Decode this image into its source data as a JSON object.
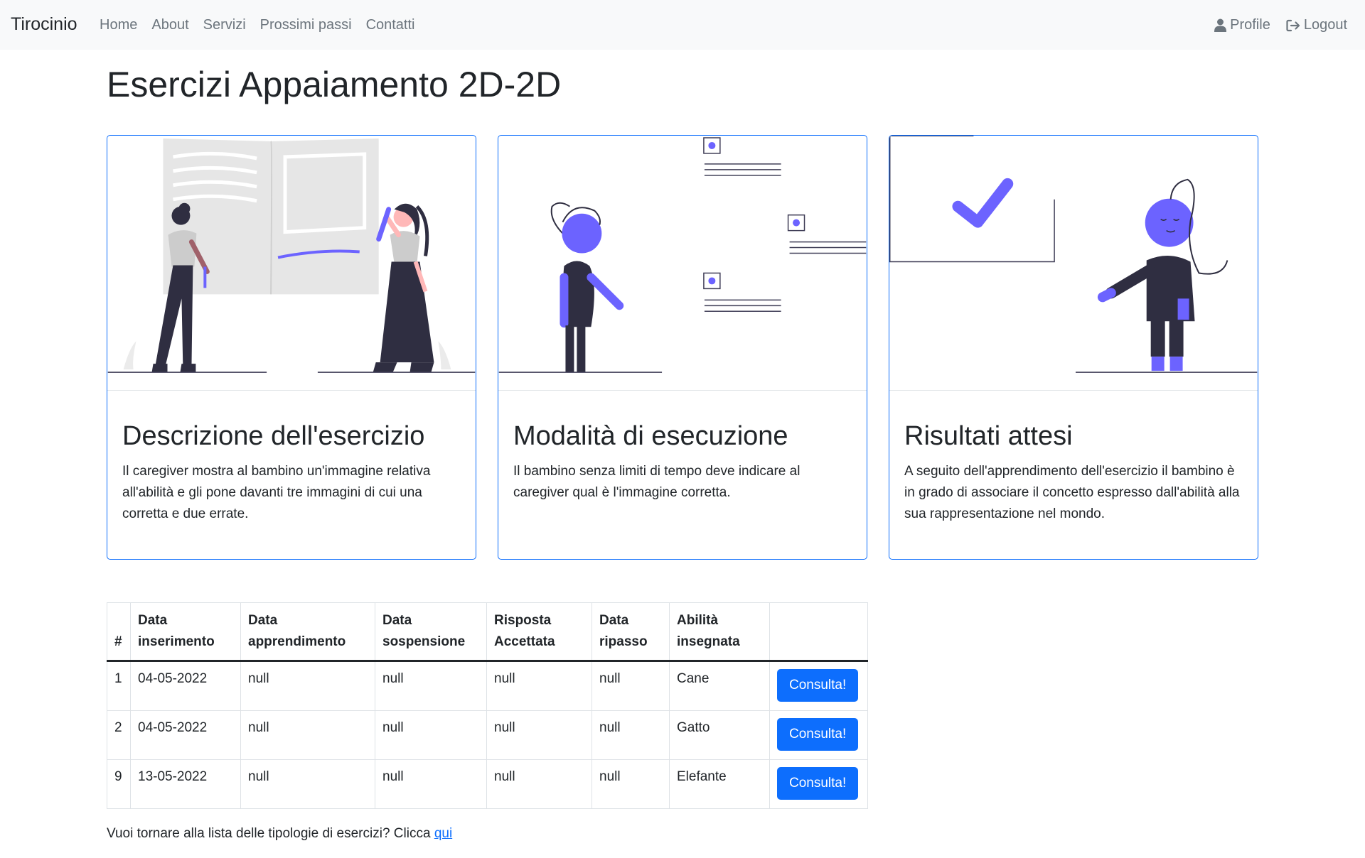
{
  "navbar": {
    "brand": "Tirocinio",
    "links": [
      "Home",
      "About",
      "Servizi",
      "Prossimi passi",
      "Contatti"
    ],
    "profile_label": "Profile",
    "logout_label": "Logout"
  },
  "page_title": "Esercizi Appaiamento 2D-2D",
  "cards": [
    {
      "title": "Descrizione dell'esercizio",
      "text": "Il caregiver mostra al bambino un'immagine relativa all'abilità e gli pone davanti tre immagini di cui una corretta e due errate."
    },
    {
      "title": "Modalità di esecuzione",
      "text": "Il bambino senza limiti di tempo deve indicare al caregiver qual è l'immagine corretta."
    },
    {
      "title": "Risultati attesi",
      "text": "A seguito dell'apprendimento dell'esercizio il bambino è in grado di associare il concetto espresso dall'abilità alla sua rappresentazione nel mondo."
    }
  ],
  "table": {
    "headers": [
      "#",
      "Data inserimento",
      "Data apprendimento",
      "Data sospensione",
      "Risposta Accettata",
      "Data ripasso",
      "Abilità insegnata",
      ""
    ],
    "rows": [
      {
        "id": "1",
        "inserimento": "04-05-2022",
        "apprendimento": "null",
        "sospensione": "null",
        "risposta": "null",
        "ripasso": "null",
        "abilita": "Cane",
        "button": "Consulta!"
      },
      {
        "id": "2",
        "inserimento": "04-05-2022",
        "apprendimento": "null",
        "sospensione": "null",
        "risposta": "null",
        "ripasso": "null",
        "abilita": "Gatto",
        "button": "Consulta!"
      },
      {
        "id": "9",
        "inserimento": "13-05-2022",
        "apprendimento": "null",
        "sospensione": "null",
        "risposta": "null",
        "ripasso": "null",
        "abilita": "Elefante",
        "button": "Consulta!"
      }
    ]
  },
  "footer": {
    "text": "Vuoi tornare alla lista delle tipologie di esercizi? Clicca",
    "link": "qui"
  },
  "colors": {
    "primary": "#0d6efd",
    "accent_illustration": "#6c63ff",
    "navbar_bg": "#f8f9fa",
    "dark": "#2f2e41"
  },
  "icons": [
    "user-icon",
    "logout-icon"
  ]
}
